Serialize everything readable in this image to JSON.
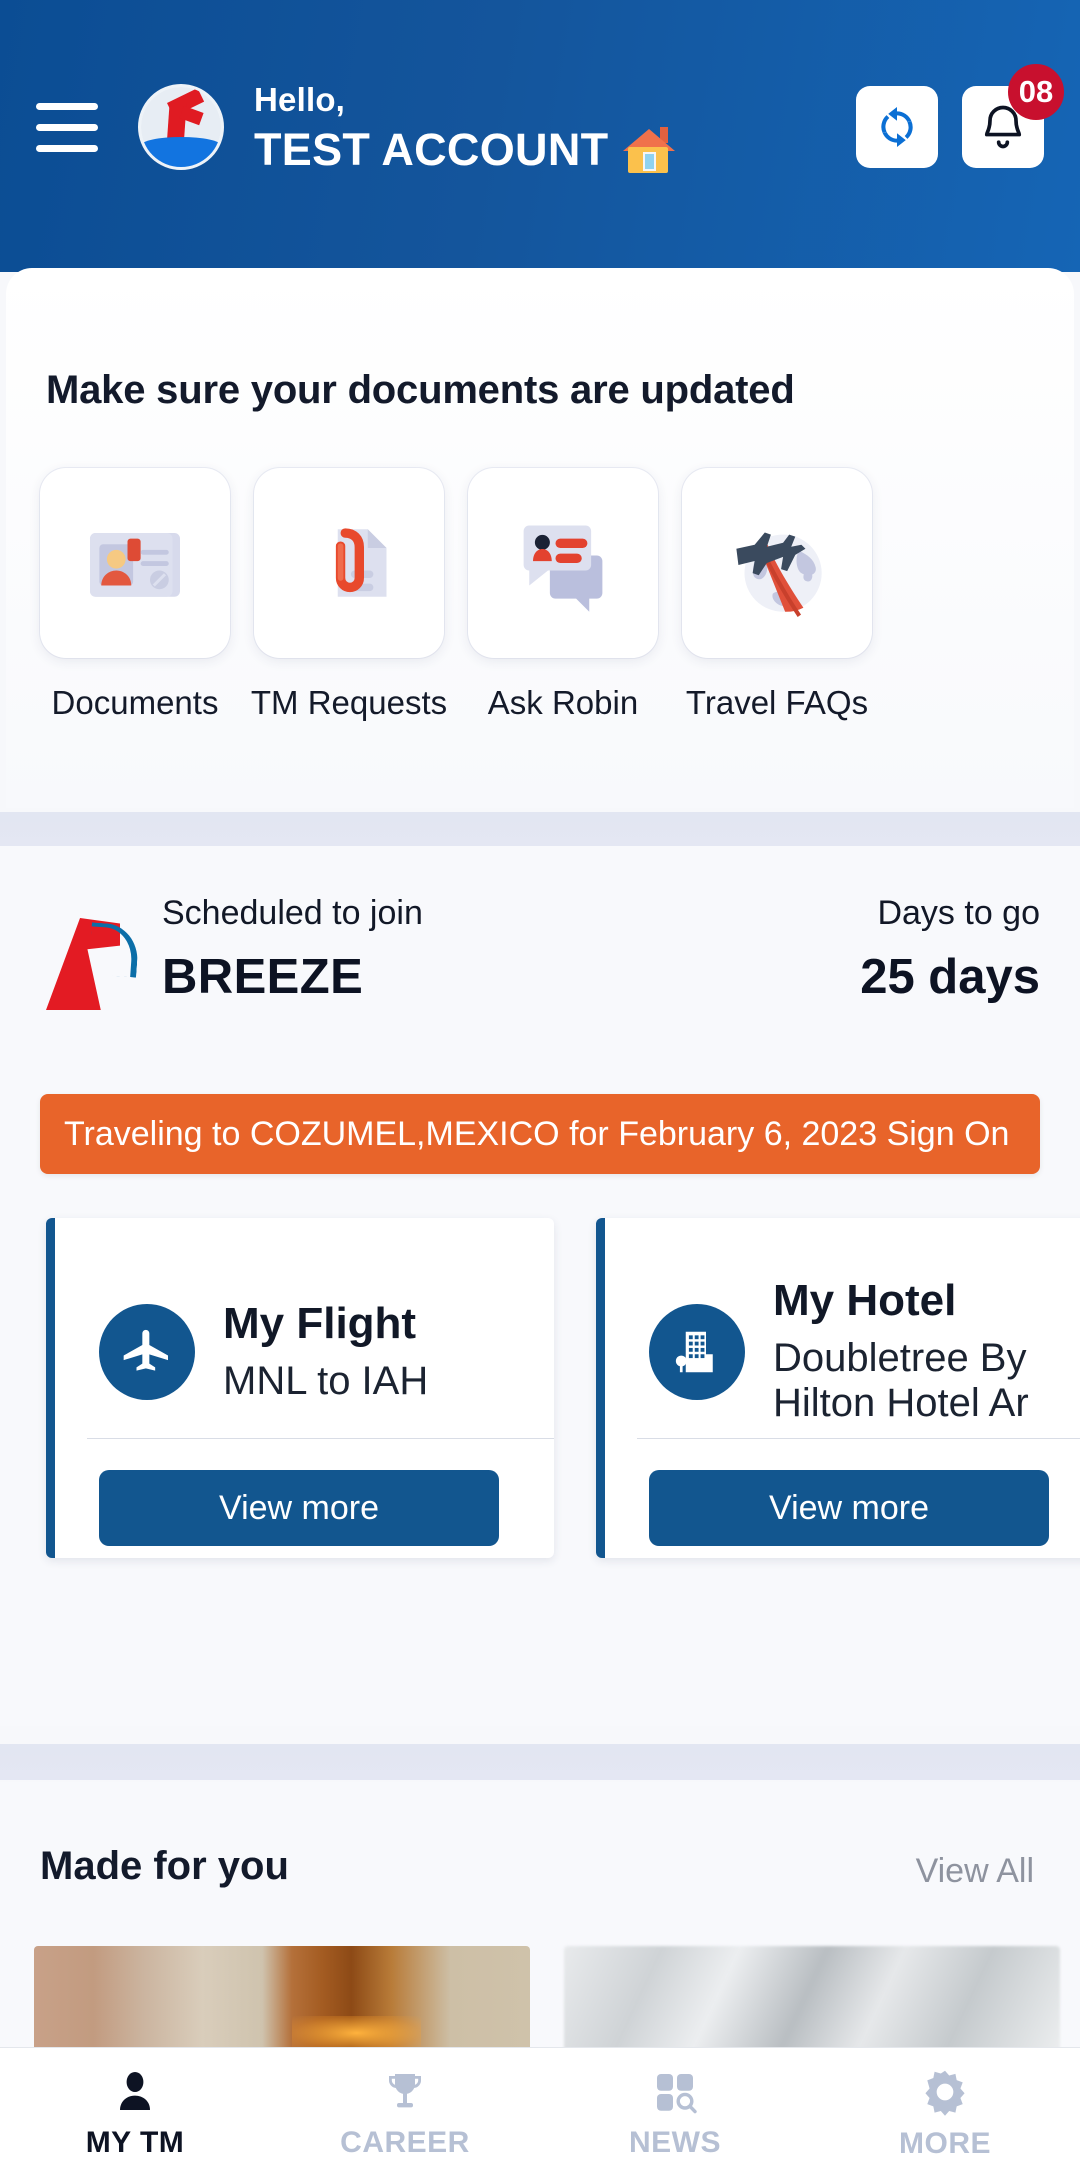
{
  "header": {
    "menu_icon": "hamburger-menu-icon",
    "avatar_icon": "carnival-logo-avatar",
    "greeting": "Hello,",
    "account_name": "TEST ACCOUNT",
    "home_icon": "house-icon",
    "refresh_icon": "refresh-sync-icon",
    "notification_icon": "bell-icon",
    "notification_count": "08"
  },
  "documents": {
    "title": "Make sure your documents are updated",
    "tiles": [
      {
        "label": "Documents",
        "icon": "id-card-icon"
      },
      {
        "label": "TM Requests",
        "icon": "paperclip-document-icon"
      },
      {
        "label": "Ask Robin",
        "icon": "chat-bubbles-icon"
      },
      {
        "label": "Travel FAQs",
        "icon": "globe-airplane-icon"
      }
    ]
  },
  "voyage": {
    "ship_logo_icon": "carnival-whale-tail-icon",
    "scheduled_label": "Scheduled to join",
    "ship_name": "BREEZE",
    "days_label": "Days to go",
    "days_value": "25 days",
    "banner_text": "Traveling to COZUMEL,MEXICO for February 6, 2023 Sign On",
    "banner_color": "#e8642a",
    "cards": [
      {
        "icon": "airplane-icon",
        "title": "My Flight",
        "subtitle": "MNL to IAH",
        "button_label": "View more"
      },
      {
        "icon": "hotel-building-icon",
        "title": "My Hotel",
        "subtitle": "Doubletree By Hilton Hotel Ar",
        "button_label": "View more"
      }
    ]
  },
  "made_for_you": {
    "title": "Made for you",
    "view_all_label": "View All",
    "cards": [
      {
        "icon": "ship-interior-photo"
      },
      {
        "icon": "blurred-photo"
      }
    ]
  },
  "bottom_nav": {
    "items": [
      {
        "label": "MY TM",
        "icon": "person-icon",
        "active": true
      },
      {
        "label": "CAREER",
        "icon": "trophy-icon",
        "active": false
      },
      {
        "label": "NEWS",
        "icon": "news-grid-search-icon",
        "active": false
      },
      {
        "label": "MORE",
        "icon": "gear-icon",
        "active": false
      }
    ]
  },
  "colors": {
    "brand_blue": "#12568f",
    "header_blue": "#0b4d94",
    "accent_orange": "#e8642a",
    "badge_red": "#c8102e"
  }
}
